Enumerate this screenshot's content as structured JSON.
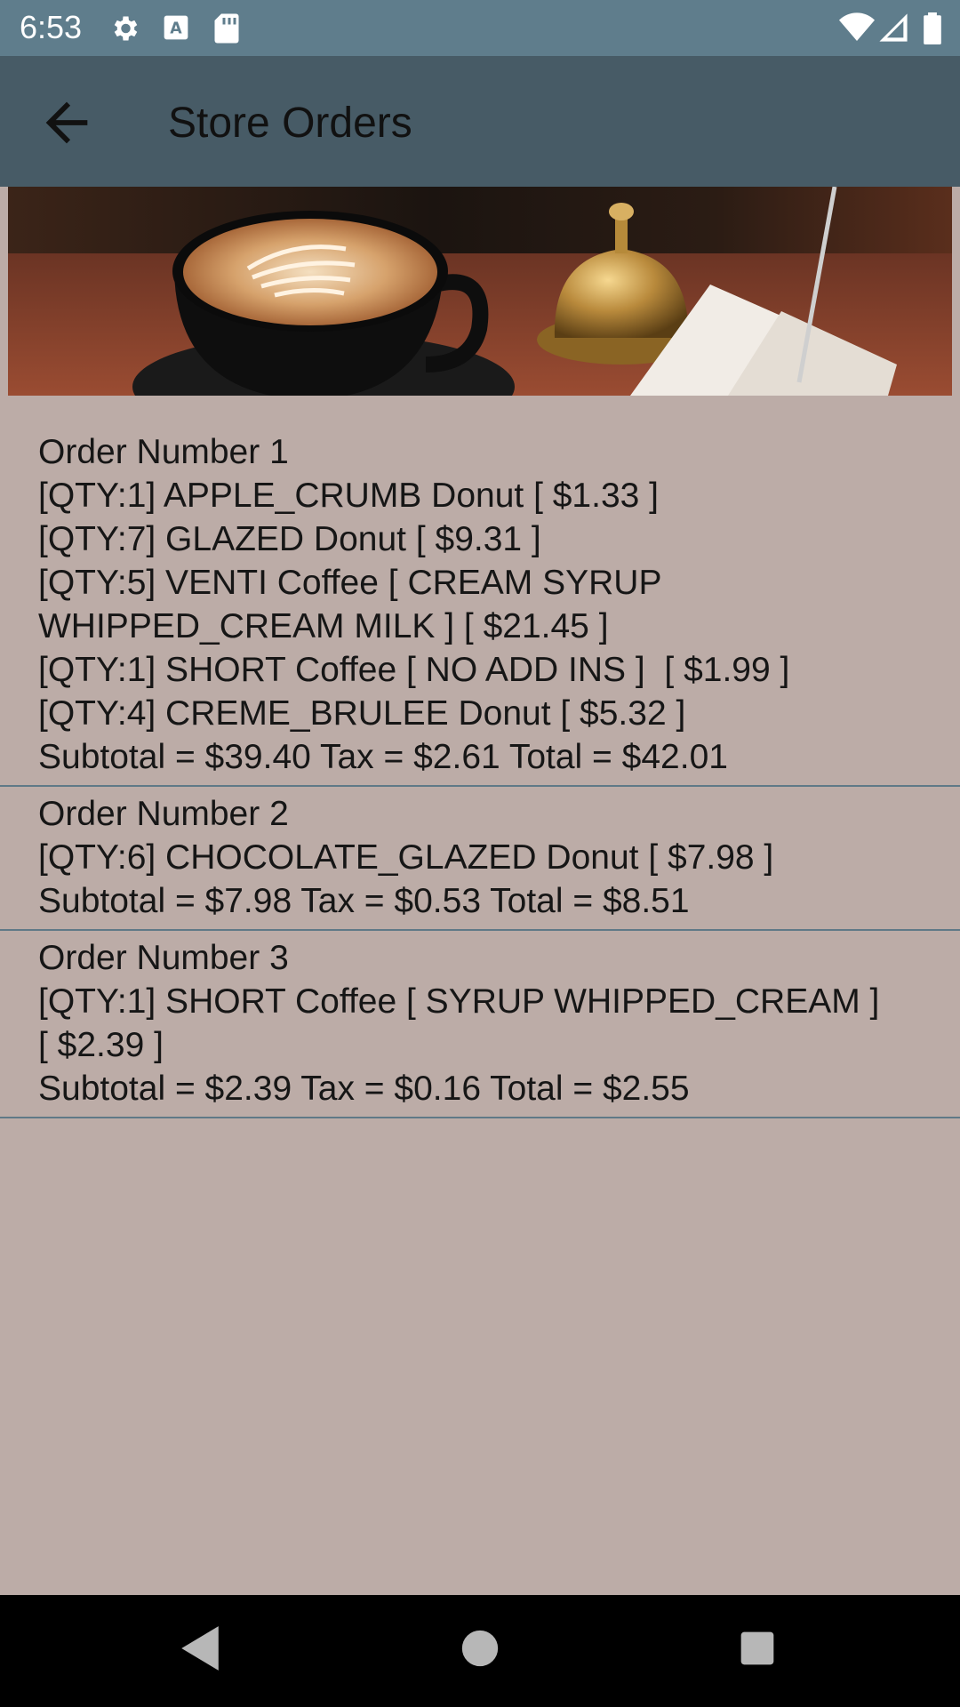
{
  "status_bar": {
    "time": "6:53",
    "icons": [
      "gear-icon",
      "font-a-icon",
      "sd-card-icon",
      "wifi-icon",
      "signal-icon",
      "battery-icon"
    ]
  },
  "app_bar": {
    "title": "Store Orders",
    "back_icon": "arrow-left-icon"
  },
  "hero": {
    "description_icon": "coffee-cup-image"
  },
  "orders": [
    {
      "lines": [
        "Order Number 1",
        "[QTY:1] APPLE_CRUMB Donut [ $1.33 ]",
        "[QTY:7] GLAZED Donut [ $9.31 ]",
        "[QTY:5] VENTI Coffee [ CREAM SYRUP WHIPPED_CREAM MILK ] [ $21.45 ]",
        "[QTY:1] SHORT Coffee [ NO ADD INS ]  [ $1.99 ]",
        "[QTY:4] CREME_BRULEE Donut [ $5.32 ]",
        "Subtotal = $39.40 Tax = $2.61 Total = $42.01"
      ]
    },
    {
      "lines": [
        "Order Number 2",
        "[QTY:6] CHOCOLATE_GLAZED Donut [ $7.98 ]",
        "Subtotal = $7.98 Tax = $0.53 Total = $8.51"
      ]
    },
    {
      "lines": [
        "Order Number 3",
        "[QTY:1] SHORT Coffee [ SYRUP WHIPPED_CREAM ] [ $2.39 ]",
        "Subtotal = $2.39 Tax = $0.16 Total = $2.55"
      ]
    }
  ],
  "nav_bar": {
    "icons": [
      "back-triangle-icon",
      "home-circle-icon",
      "recents-square-icon"
    ]
  },
  "colors": {
    "status_bar": "#5f7d8c",
    "app_bar": "#475b66",
    "background": "#bcaca7",
    "divider": "#5f7987"
  }
}
